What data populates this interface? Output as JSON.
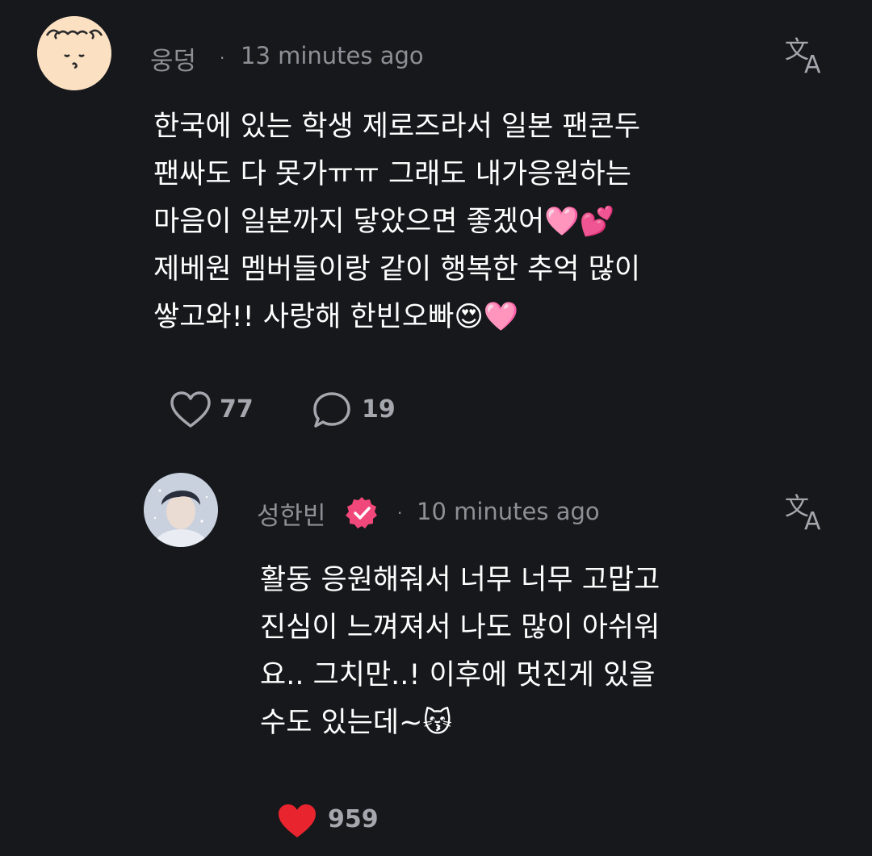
{
  "comment": {
    "username": "웅덩",
    "timestamp": "13 minutes ago",
    "text": "한국에 있는 학생 제로즈라서 일본 팬콘두\n팬싸도 다 못가ㅠㅠ 그래도 내가응원하는\n마음이 일본까지 닿았으면 좋겠어🩷💕\n제베원 멤버들이랑 같이 행복한 추억 많이\n쌓고와!! 사랑해 한빈오빠😍🩷",
    "like_count": "77",
    "reply_count": "19",
    "avatar_icon": "smiling-face-avatar"
  },
  "reply": {
    "username": "성한빈",
    "verified_icon": "verified-badge-icon",
    "timestamp": "10 minutes ago",
    "text": "활동 응원해줘서 너무 너무 고맙고\n진심이 느껴져서 나도 많이 아쉬워\n요.. 그치만..! 이후에 멋진게 있을\n수도 있는데~😽",
    "like_count": "959",
    "liked": true
  },
  "colors": {
    "background": "#16181b",
    "muted_text": "#8d9096",
    "liked_heart": "#e8242e",
    "verified_badge": "#f0487a"
  },
  "separator": "·"
}
